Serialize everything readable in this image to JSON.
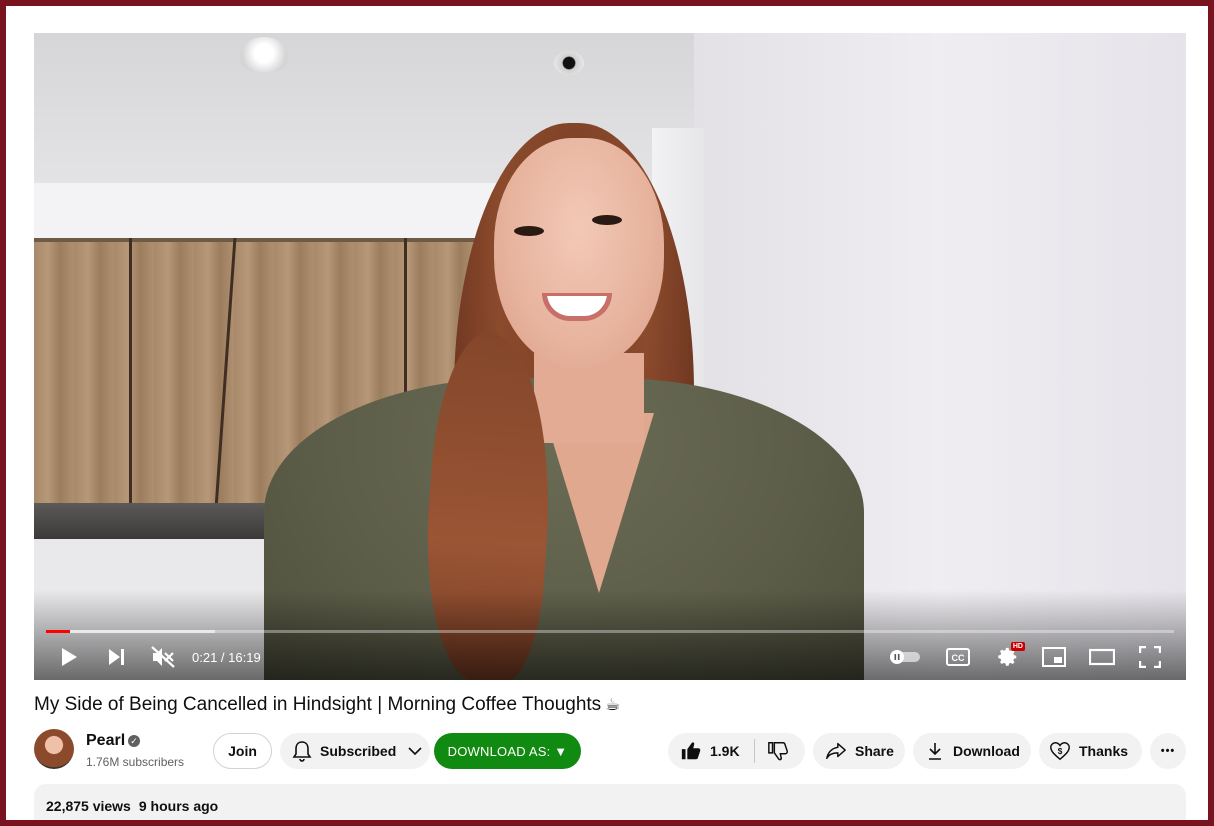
{
  "player": {
    "current_time": "0:21",
    "duration": "16:19",
    "time_separator": " / ",
    "progress_fraction": 0.0214,
    "buffer_fraction": 0.15,
    "hd_badge": "HD",
    "autoplay": "off",
    "muted": true
  },
  "video": {
    "title": "My Side of Being Cancelled in Hindsight | Morning Coffee Thoughts",
    "title_emoji": "☕"
  },
  "channel": {
    "name": "Pearl",
    "verified_glyph": "✓",
    "subscribers": "1.76M subscribers"
  },
  "actions": {
    "join_label": "Join",
    "subscribed_label": "Subscribed",
    "download_as_label": "DOWNLOAD AS: ▼",
    "like_count": "1.9K",
    "share_label": "Share",
    "download_label": "Download",
    "thanks_label": "Thanks",
    "more_label": "•••"
  },
  "description": {
    "views": "22,875 views",
    "age": "9 hours ago"
  },
  "colors": {
    "frame": "#7a1320",
    "progress": "#ff0000",
    "download_as_bg": "#118a11"
  }
}
